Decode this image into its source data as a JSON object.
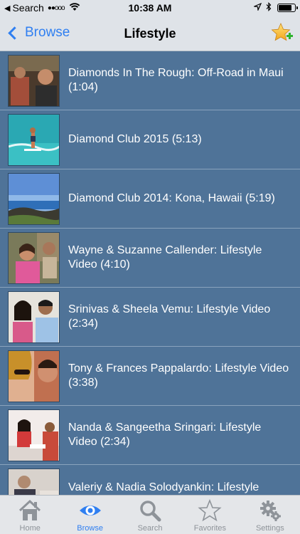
{
  "status_bar": {
    "back_app": "Search",
    "signal": "●●ooo",
    "time": "10:38 AM",
    "battery_level": 0.9
  },
  "nav": {
    "back_label": "Browse",
    "title": "Lifestyle"
  },
  "videos": [
    {
      "title": "Diamonds In The Rough: Off-Road in Maui (1:04)"
    },
    {
      "title": "Diamond Club 2015 (5:13)"
    },
    {
      "title": "Diamond Club 2014: Kona, Hawaii (5:19)"
    },
    {
      "title": "Wayne & Suzanne Callender: Lifestyle Video (4:10)"
    },
    {
      "title": "Srinivas & Sheela Vemu: Lifestyle Video (2:34)"
    },
    {
      "title": "Tony & Frances Pappalardo: Lifestyle Video (3:38)"
    },
    {
      "title": "Nanda & Sangeetha Sringari: Lifestyle Video (2:34)"
    },
    {
      "title": "Valeriy & Nadia Solodyankin: Lifestyle"
    }
  ],
  "tabs": [
    {
      "label": "Home",
      "icon": "house-icon"
    },
    {
      "label": "Browse",
      "icon": "eye-icon"
    },
    {
      "label": "Search",
      "icon": "magnifier-icon"
    },
    {
      "label": "Favorites",
      "icon": "star-icon"
    },
    {
      "label": "Settings",
      "icon": "gear-icon"
    }
  ],
  "colors": {
    "accent": "#2f7ff1",
    "list_bg": "#4f7398",
    "bar_bg": "#dfe3e8"
  }
}
